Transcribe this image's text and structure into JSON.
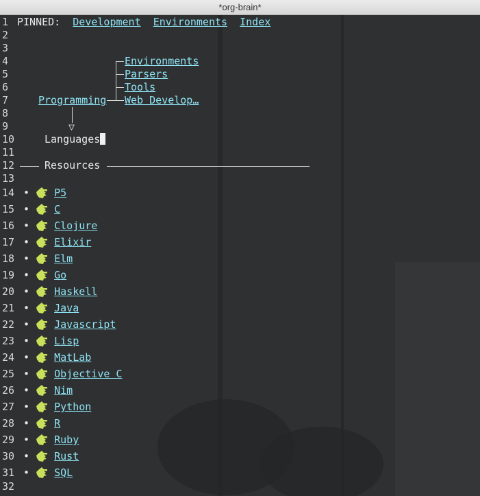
{
  "window": {
    "title": "*org-brain*"
  },
  "pinned": {
    "label": "PINNED:",
    "links": [
      "Development",
      "Environments",
      "Index"
    ]
  },
  "tree": {
    "parent": "Programming",
    "siblings": [
      "Environments",
      "Parsers",
      "Tools",
      "Web Develop…"
    ],
    "arrow": "▽",
    "current": "Languages"
  },
  "resources": {
    "label": "Resources"
  },
  "languages": [
    "P5",
    "C",
    "Clojure",
    "Elixir",
    "Elm",
    "Go",
    "Haskell",
    "Java",
    "Javascript",
    "Lisp",
    "MatLab",
    "Objective C",
    "Nim",
    "Python",
    "R",
    "Ruby",
    "Rust",
    "SQL"
  ],
  "line_numbers": [
    "1",
    "2",
    "3",
    "4",
    "5",
    "6",
    "7",
    "8",
    "9",
    "10",
    "11",
    "12",
    "13",
    "14",
    "15",
    "16",
    "17",
    "18",
    "19",
    "20",
    "21",
    "22",
    "23",
    "24",
    "25",
    "26",
    "27",
    "28",
    "29",
    "30",
    "31",
    "32"
  ],
  "bullet": "•",
  "colors": {
    "link": "#8fe3f4",
    "background": "#2e3031",
    "icon": "#c8e05a"
  },
  "icon_name": "hand-pointer-icon"
}
